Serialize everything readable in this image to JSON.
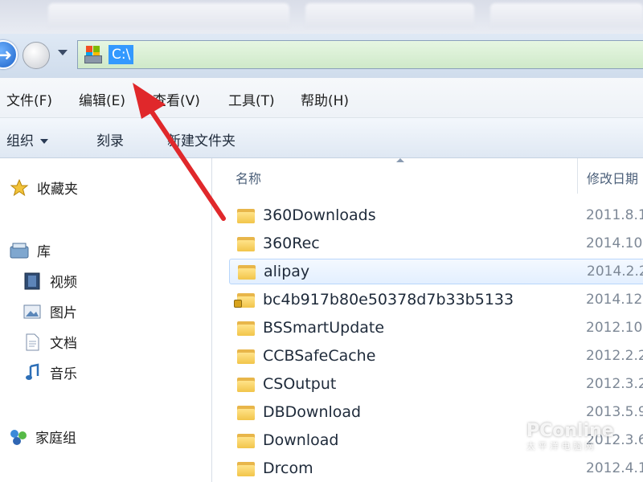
{
  "address": {
    "path": "C:\\"
  },
  "menu": [
    "文件(F)",
    "编辑(E)",
    "查看(V)",
    "工具(T)",
    "帮助(H)"
  ],
  "toolbar": {
    "organize": "组织",
    "burn": "刻录",
    "new_folder": "新建文件夹"
  },
  "nav": {
    "favorites": "收藏夹",
    "libraries": "库",
    "videos": "视频",
    "pictures": "图片",
    "documents": "文档",
    "music": "音乐",
    "homegroup": "家庭组"
  },
  "columns": {
    "name": "名称",
    "date": "修改日期"
  },
  "files": [
    {
      "name": "360Downloads",
      "date": "2011.8.1",
      "selected": false,
      "locked": false
    },
    {
      "name": "360Rec",
      "date": "2014.10",
      "selected": false,
      "locked": false
    },
    {
      "name": "alipay",
      "date": "2014.2.2",
      "selected": true,
      "locked": false
    },
    {
      "name": "bc4b917b80e50378d7b33b5133",
      "date": "2014.12",
      "selected": false,
      "locked": true
    },
    {
      "name": "BSSmartUpdate",
      "date": "2012.10",
      "selected": false,
      "locked": false
    },
    {
      "name": "CCBSafeCache",
      "date": "2012.2.2",
      "selected": false,
      "locked": false
    },
    {
      "name": "CSOutput",
      "date": "2012.3.2",
      "selected": false,
      "locked": false
    },
    {
      "name": "DBDownload",
      "date": "2013.5.9",
      "selected": false,
      "locked": false
    },
    {
      "name": "Download",
      "date": "2012.3.6",
      "selected": false,
      "locked": false
    },
    {
      "name": "Drcom",
      "date": "2012.4.1",
      "selected": false,
      "locked": false
    }
  ],
  "watermark": {
    "main": "PConline",
    "sub": "太 平 洋 电 脑 网"
  },
  "colors": {
    "arrow": "#e0282b",
    "selection": "#cce4ff",
    "address_bg": "#d5eccf"
  }
}
